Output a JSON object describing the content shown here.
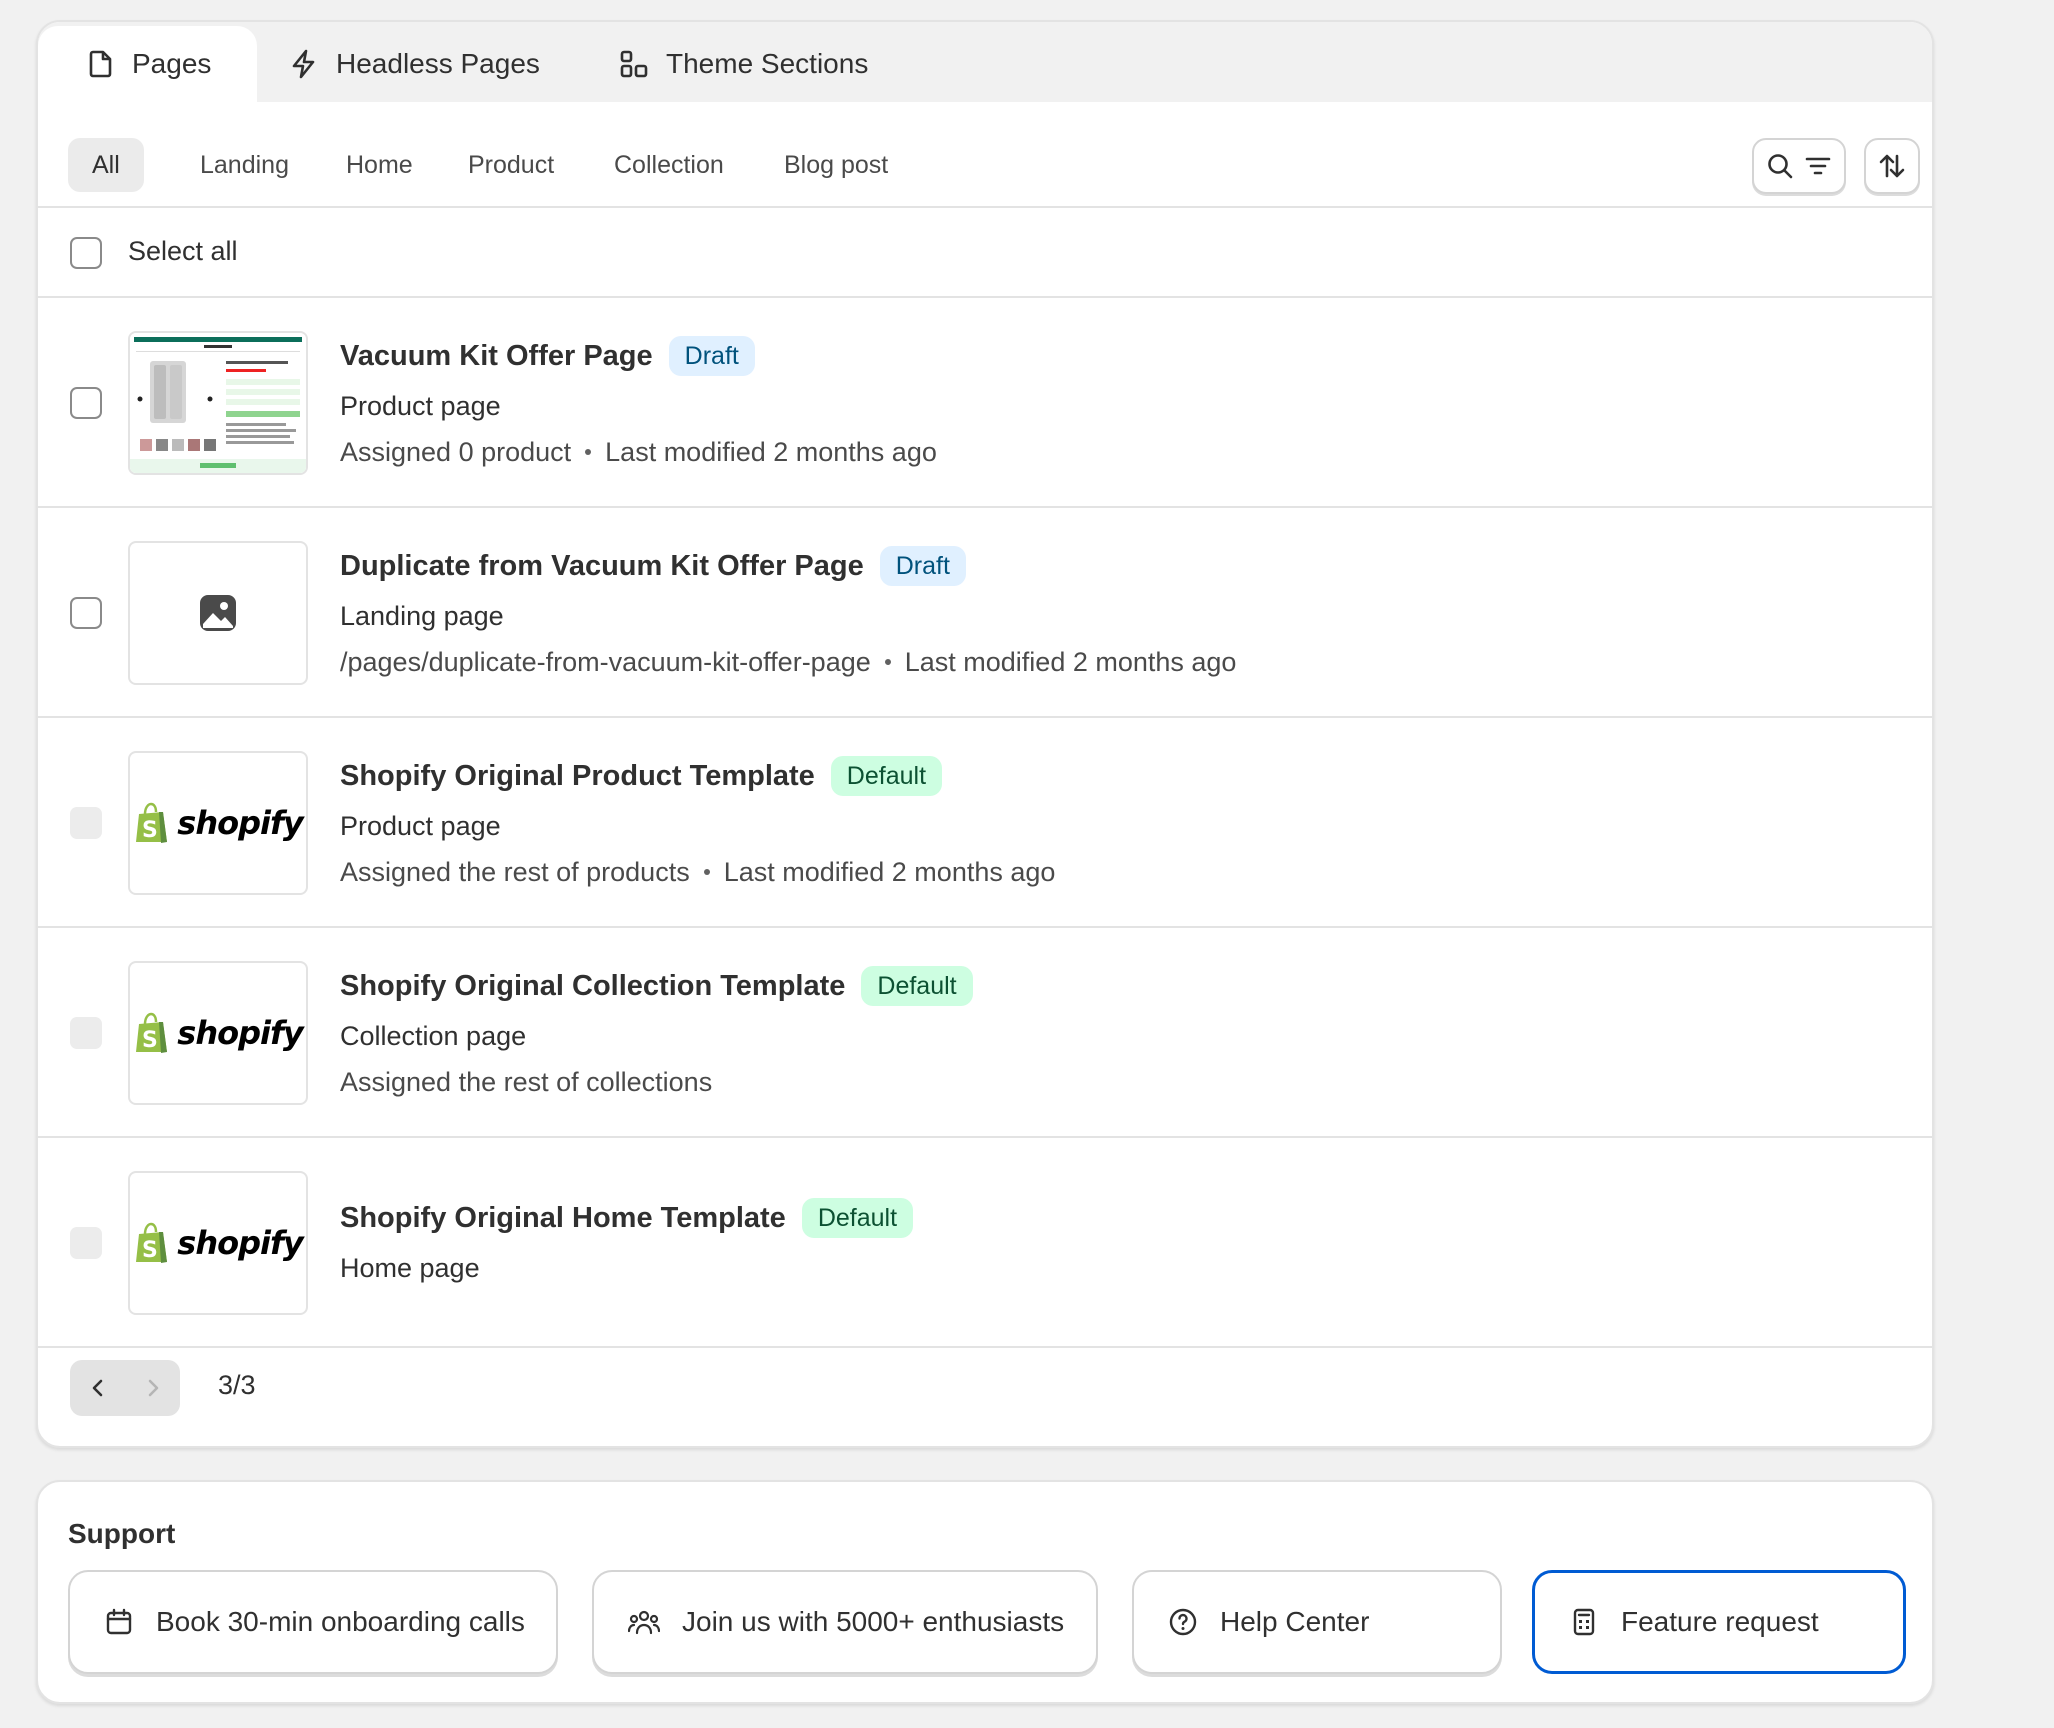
{
  "tabs": [
    {
      "label": "Pages",
      "icon": "page-icon"
    },
    {
      "label": "Headless Pages",
      "icon": "lightning-icon"
    },
    {
      "label": "Theme Sections",
      "icon": "sections-icon"
    }
  ],
  "filters": [
    "All",
    "Landing",
    "Home",
    "Product",
    "Collection",
    "Blog post"
  ],
  "select_all_label": "Select all",
  "rows": [
    {
      "title": "Vacuum Kit Offer Page",
      "badge": "Draft",
      "type": "Product page",
      "detail": "Assigned 0 product",
      "modified": "Last modified 2 months ago",
      "thumb": "page-preview"
    },
    {
      "title": "Duplicate from Vacuum Kit Offer Page",
      "badge": "Draft",
      "type": "Landing page",
      "detail": "/pages/duplicate-from-vacuum-kit-offer-page",
      "modified": "Last modified 2 months ago",
      "thumb": "image-placeholder-icon"
    },
    {
      "title": "Shopify Original Product Template",
      "badge": "Default",
      "type": "Product page",
      "detail": "Assigned the rest of products",
      "modified": "Last modified 2 months ago",
      "thumb": "shopify-logo"
    },
    {
      "title": "Shopify Original Collection Template",
      "badge": "Default",
      "type": "Collection page",
      "detail": "Assigned the rest of collections",
      "modified": "",
      "thumb": "shopify-logo"
    },
    {
      "title": "Shopify Original Home Template",
      "badge": "Default",
      "type": "Home page",
      "detail": "",
      "modified": "",
      "thumb": "shopify-logo"
    }
  ],
  "shopify_wordmark": "shopify",
  "pagination": {
    "label": "3/3"
  },
  "support": {
    "title": "Support",
    "buttons": [
      {
        "label": "Book 30-min onboarding calls",
        "icon": "calendar-icon"
      },
      {
        "label": "Join us with 5000+ enthusiasts",
        "icon": "community-icon"
      },
      {
        "label": "Help Center",
        "icon": "question-circle-icon"
      },
      {
        "label": "Feature request",
        "icon": "form-icon"
      }
    ]
  },
  "colors": {
    "draft_bg": "#e0f0ff",
    "draft_text": "#00527c",
    "default_bg": "#cdfee1",
    "default_text": "#0c5132",
    "focus_ring": "#005bd3",
    "shopify_green": "#95bf47"
  }
}
